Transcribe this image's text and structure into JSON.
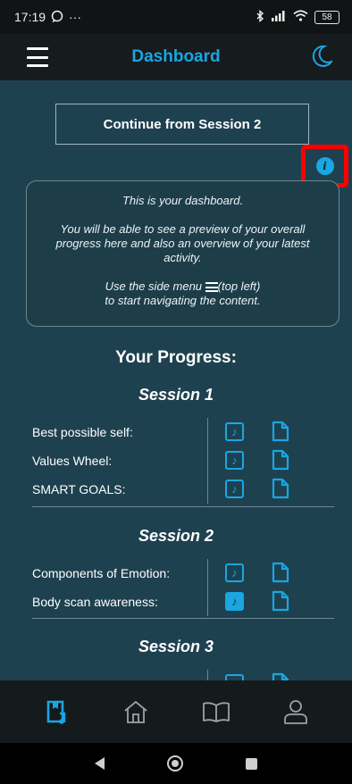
{
  "status_bar": {
    "time": "17:19",
    "icons_left": [
      "whatsapp-icon",
      "more-dots"
    ],
    "icons_right": [
      "bluetooth-icon",
      "signal-icon",
      "wifi-icon",
      "battery-icon"
    ],
    "battery": "58"
  },
  "header": {
    "title": "Dashboard",
    "accent": "#1aa6e0"
  },
  "continue_button": "Continue from Session 2",
  "info_card": {
    "line1": "This is your dashboard.",
    "line2": "You will be able to see a preview of your overall progress here and also an overview of your latest activity.",
    "line3_before": "Use the side menu",
    "line3_after": "(top left)",
    "line4": "to start navigating the content."
  },
  "progress": {
    "title": "Your Progress:",
    "sessions": [
      {
        "title": "Session 1",
        "items": [
          {
            "label": "Best possible self:",
            "audio_completed": false
          },
          {
            "label": "Values Wheel:",
            "audio_completed": false
          },
          {
            "label": "SMART GOALS:",
            "audio_completed": false
          }
        ]
      },
      {
        "title": "Session 2",
        "items": [
          {
            "label": "Components of Emotion:",
            "audio_completed": false
          },
          {
            "label": "Body scan awareness:",
            "audio_completed": true
          }
        ]
      },
      {
        "title": "Session 3",
        "items": []
      }
    ]
  },
  "bottom_nav": [
    "dashboard-icon",
    "home-icon",
    "book-icon",
    "profile-icon"
  ],
  "colors": {
    "background": "#1e4150",
    "accent": "#1aa6e0",
    "highlight": "#ff0000"
  }
}
